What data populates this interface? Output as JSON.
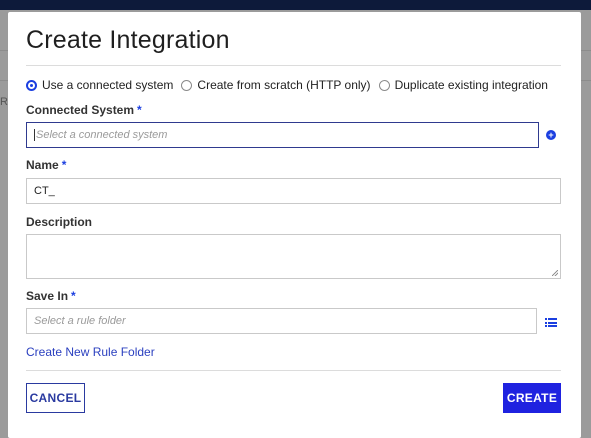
{
  "background": {
    "row_label": "R"
  },
  "dialog": {
    "title": "Create Integration",
    "source_options": [
      {
        "label": "Use a connected system",
        "selected": true
      },
      {
        "label": "Create from scratch (HTTP only)",
        "selected": false
      },
      {
        "label": "Duplicate existing integration",
        "selected": false
      }
    ],
    "connected_system": {
      "label": "Connected System",
      "required_mark": "*",
      "placeholder": "Select a connected system",
      "add_icon": "plus-circle-icon"
    },
    "name": {
      "label": "Name",
      "required_mark": "*",
      "value": "CT_"
    },
    "description": {
      "label": "Description",
      "value": ""
    },
    "save_in": {
      "label": "Save In",
      "required_mark": "*",
      "placeholder": "Select a rule folder",
      "browse_icon": "list-icon"
    },
    "create_folder_link": "Create New Rule Folder",
    "cancel_label": "CANCEL",
    "create_label": "CREATE"
  },
  "colors": {
    "accent": "#1f22e0",
    "link": "#2a3fbf",
    "overlay": "#9b9b9b"
  }
}
